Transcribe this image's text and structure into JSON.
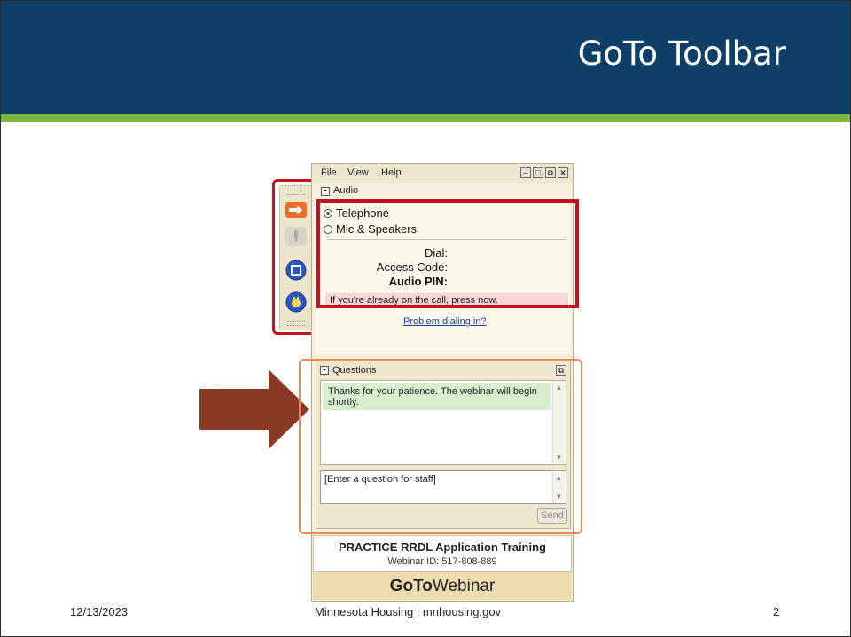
{
  "slide": {
    "title": "GoTo Toolbar",
    "footer_date": "12/13/2023",
    "footer_center": "Minnesota Housing  |  mnhousing.gov",
    "page_number": "2",
    "colors": {
      "header": "#0e3f66",
      "accent_stripe": "#7ab43f",
      "highlight_red": "#c0131d",
      "highlight_orange": "#ec8a4d",
      "arrow": "#8a3a24"
    }
  },
  "side_toolbar": {
    "buttons": [
      {
        "icon": "show-panel-arrow-icon",
        "color": "#e8712a"
      },
      {
        "icon": "microphone-icon",
        "color": "#b8b8b8"
      },
      {
        "icon": "screen-share-icon",
        "color": "#2a56c8"
      },
      {
        "icon": "raise-hand-icon",
        "color": "#2a56c8"
      }
    ]
  },
  "window": {
    "menu": [
      "File",
      "View",
      "Help"
    ],
    "audio": {
      "section_label": "Audio",
      "options": [
        "Telephone",
        "Mic & Speakers"
      ],
      "selected": "Telephone",
      "dial_label": "Dial:",
      "access_code_label": "Access Code:",
      "audio_pin_label": "Audio PIN:",
      "notice": "If you're already on the call, press        now.",
      "problem_link": "Problem dialing in?"
    },
    "questions": {
      "section_label": "Questions",
      "message": "Thanks for your patience.  The webinar will begin shortly.",
      "input_placeholder": "[Enter a question for staff]",
      "send_label": "Send"
    },
    "session": {
      "title": "PRACTICE RRDL Application Training",
      "webinar_id": "Webinar ID: 517-808-889"
    },
    "brand_bold": "GoTo",
    "brand_rest": "Webinar"
  }
}
